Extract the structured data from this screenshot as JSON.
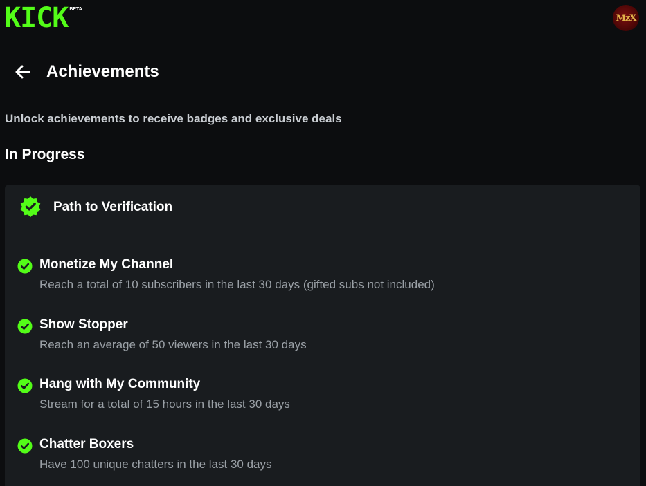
{
  "header": {
    "logo_text": "KICK",
    "logo_badge": "BETA",
    "avatar_text": "MzX"
  },
  "page": {
    "title": "Achievements",
    "subtitle": "Unlock achievements to receive badges and exclusive deals",
    "section_title": "In Progress"
  },
  "card": {
    "title": "Path to Verification",
    "items": [
      {
        "title": "Monetize My Channel",
        "description": "Reach a total of 10 subscribers in the last 30 days (gifted subs not included)",
        "completed": true
      },
      {
        "title": "Show Stopper",
        "description": "Reach an average of 50 viewers in the last 30 days",
        "completed": true
      },
      {
        "title": "Hang with My Community",
        "description": "Stream for a total of 15 hours in the last 30 days",
        "completed": true
      },
      {
        "title": "Chatter Boxers",
        "description": "Have 100 unique chatters in the last 30 days",
        "completed": true
      }
    ]
  },
  "icons": {
    "back": "arrow-left-icon",
    "verification": "verified-badge-icon",
    "check": "check-circle-icon"
  },
  "colors": {
    "accent": "#53fc18",
    "background": "#0c0d0f",
    "card": "#191c1f"
  }
}
